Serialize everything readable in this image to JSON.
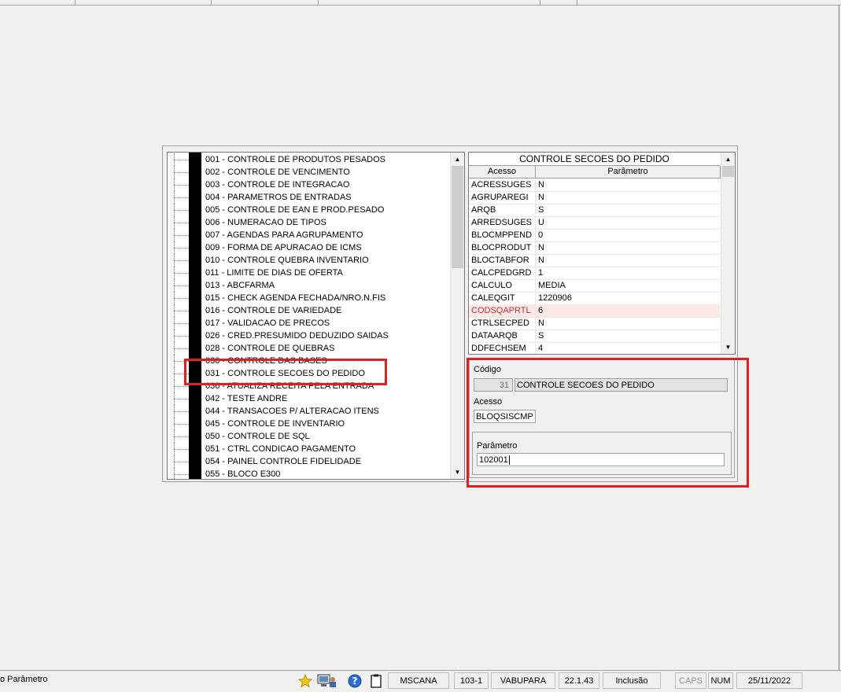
{
  "tree": {
    "items": [
      "001 - CONTROLE DE PRODUTOS PESADOS",
      "002 - CONTROLE DE VENCIMENTO",
      "003 - CONTROLE DE INTEGRACAO",
      "004 - PARAMETROS DE ENTRADAS",
      "005 - CONTROLE DE EAN E PROD.PESADO",
      "006 - NUMERACAO DE TIPOS",
      "007 - AGENDAS PARA AGRUPAMENTO",
      "009 - FORMA DE APURACAO DE ICMS",
      "010 - CONTROLE QUEBRA INVENTARIO",
      "011 - LIMITE DE DIAS DE OFERTA",
      "013 - ABCFARMA",
      "015 - CHECK AGENDA FECHADA/NRO.N.FIS",
      "016 - CONTROLE DE VARIEDADE",
      "017 - VALIDACAO DE PRECOS",
      "026 - CRED.PRESUMIDO DEDUZIDO SAIDAS",
      "028 - CONTROLE DE QUEBRAS",
      "030 - CONTROLE DAS BASES",
      "031 - CONTROLE SECOES DO PEDIDO",
      "036 - ATUALIZA RECEITA PELA ENTRADA",
      "042 - TESTE ANDRE",
      "044 - TRANSACOES P/ ALTERACAO ITENS",
      "045 - CONTROLE DE INVENTARIO",
      "050 - CONTROLE DE SQL",
      "051 - CTRL CONDICAO PAGAMENTO",
      "054 - PAINEL CONTROLE FIDELIDADE",
      "055 - BLOCO E300"
    ]
  },
  "grid": {
    "title": "CONTROLE SECOES DO PEDIDO",
    "col_acesso": "Acesso",
    "col_parametro": "Parâmetro",
    "rows": [
      {
        "acesso": "ACRESSUGES",
        "parametro": "N"
      },
      {
        "acesso": "AGRUPAREGI",
        "parametro": "N"
      },
      {
        "acesso": "ARQB",
        "parametro": "S"
      },
      {
        "acesso": "ARREDSUGES",
        "parametro": "U"
      },
      {
        "acesso": "BLOCMPPEND",
        "parametro": "0"
      },
      {
        "acesso": "BLOCPRODUT",
        "parametro": "N"
      },
      {
        "acesso": "BLOCTABFOR",
        "parametro": "N"
      },
      {
        "acesso": "CALCPEDGRD",
        "parametro": "1"
      },
      {
        "acesso": "CALCULO",
        "parametro": "MEDIA"
      },
      {
        "acesso": "CALEQGIT",
        "parametro": "1220906"
      },
      {
        "acesso": "CODSQAPRTL",
        "parametro": "6"
      },
      {
        "acesso": "CTRLSECPED",
        "parametro": "N"
      },
      {
        "acesso": "DATAARQB",
        "parametro": "S"
      },
      {
        "acesso": "DDFECHSEM",
        "parametro": "4"
      }
    ],
    "selected_index": 10
  },
  "form": {
    "codigo_label": "Código",
    "codigo_value": "31",
    "codigo_desc": "CONTROLE SECOES DO PEDIDO",
    "acesso_label": "Acesso",
    "acesso_value": "BLOQSISCMP",
    "parametro_label": "Parâmetro",
    "parametro_value": "102001"
  },
  "status": {
    "left_text": "o Parâmetro",
    "user": "MSCANA",
    "code": "103-1",
    "company": "VABUPARA",
    "version": "22.1.43",
    "mode": "Inclusão",
    "caps": "CAPS",
    "num": "NUM",
    "date": "25/11/2022"
  },
  "icons": [
    "star-icon",
    "computer-user-icon",
    "help-icon",
    "clipboard-icon"
  ],
  "colors": {
    "highlight": "#e02020",
    "selected_row": "#fde8e8"
  }
}
